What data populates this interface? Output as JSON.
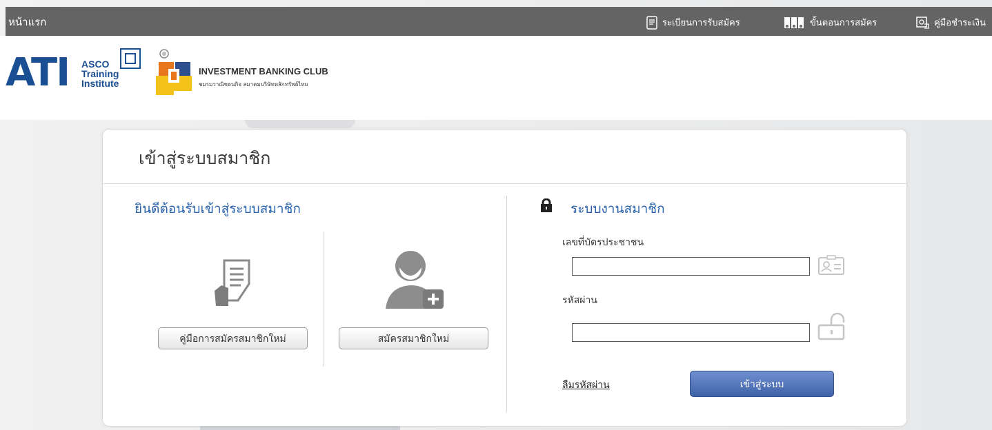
{
  "topbar": {
    "home": "หน้าแรก",
    "nav": [
      {
        "label": "ระเบียนการรับสมัคร",
        "icon": "document-icon"
      },
      {
        "label": "ขั้นตอนการสมัคร",
        "icon": "steps-icon"
      },
      {
        "label": "คู่มือชำระเงิน",
        "icon": "payment-guide-icon"
      }
    ]
  },
  "logos": {
    "ati": {
      "main": "ATI",
      "line1": "ASCO",
      "line2": "Training",
      "line3": "Institute"
    },
    "ibc": {
      "title": "INVESTMENT BANKING CLUB",
      "subtitle": "ชมรมวาณิชธนกิจ สมาคมบริษัทหลักทรัพย์ไทย"
    }
  },
  "panel": {
    "title": "เข้าสู่ระบบสมาชิก",
    "welcome": "ยินดีต้อนรับเข้าสู่ระบบสมาชิก",
    "guide_button": "คู่มือการสมัครสมาชิกใหม่",
    "register_button": "สมัครสมาชิกใหม่",
    "member_title": "ระบบงานสมาชิก",
    "id_label": "เลขที่บัตรประชาชน",
    "id_value": "",
    "password_label": "รหัสผ่าน",
    "password_value": "",
    "forgot_link": "ลืมรหัสผ่าน",
    "login_button": "เข้าสู่ระบบ"
  },
  "colors": {
    "topbar": "#646464",
    "accent_blue": "#2a63ad",
    "login_button": "#4a6db5",
    "ati_blue": "#1b4f93",
    "ibc_orange": "#e8761c",
    "ibc_yellow": "#f3c21b"
  }
}
